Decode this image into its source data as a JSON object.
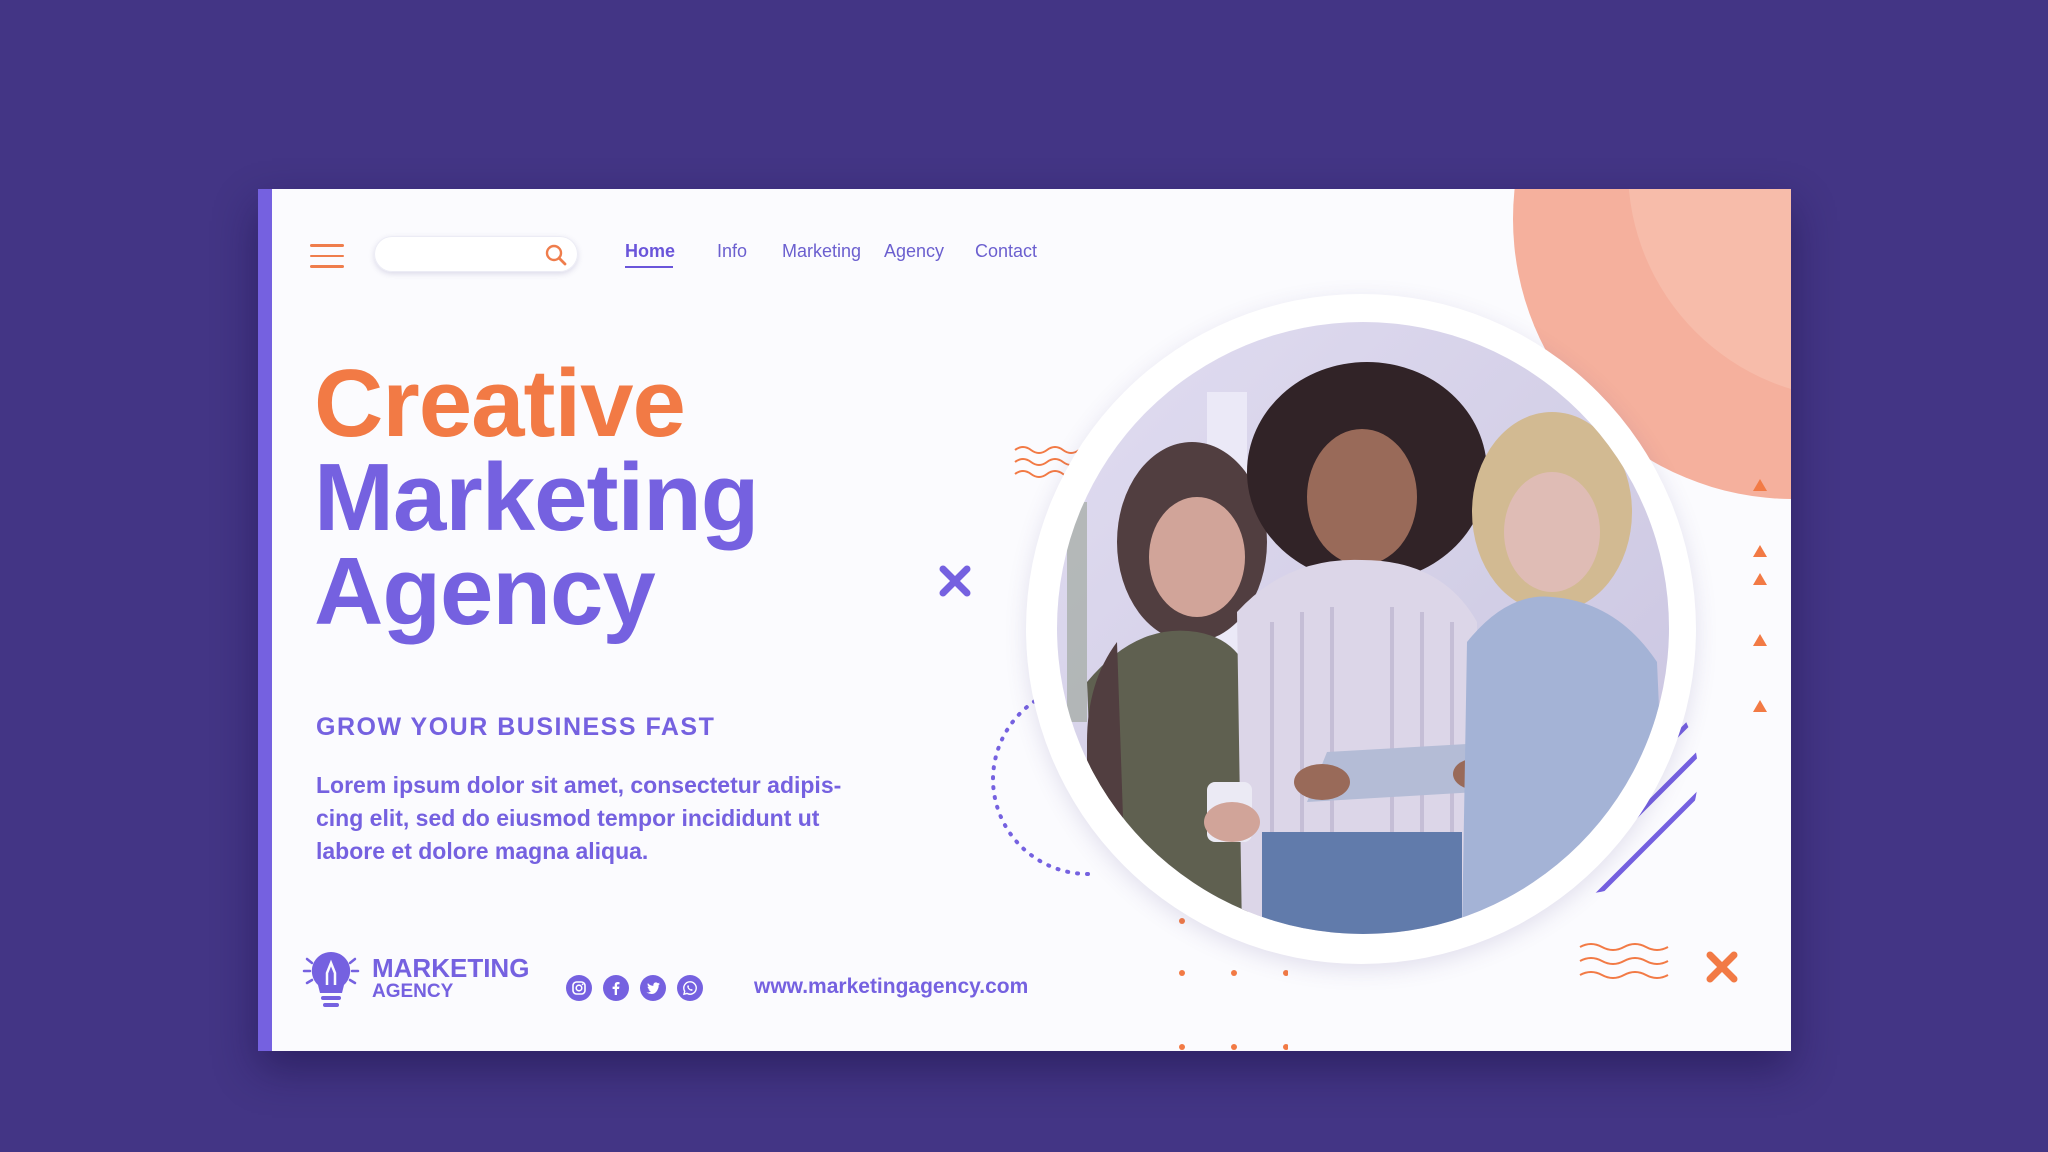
{
  "nav": {
    "items": [
      {
        "label": "Home",
        "active": true
      },
      {
        "label": "Info",
        "active": false
      },
      {
        "label": "Marketing",
        "active": false
      },
      {
        "label": "Agency",
        "active": false
      },
      {
        "label": "Contact",
        "active": false
      }
    ]
  },
  "search": {
    "placeholder": "",
    "value": ""
  },
  "hero": {
    "title_line1": "Creative",
    "title_line2": "Marketing",
    "title_line3": "Agency",
    "subtitle": "GROW YOUR BUSINESS FAST",
    "description_lines": [
      "Lorem ipsum dolor sit amet, consectetur adipis-",
      "cing elit, sed do eiusmod tempor incididunt ut",
      "labore et dolore magna aliqua."
    ]
  },
  "footer": {
    "brand_line1": "MARKETING",
    "brand_line2": "AGENCY",
    "social_icons": [
      "instagram-icon",
      "facebook-icon",
      "twitter-icon",
      "whatsapp-icon"
    ],
    "url": "www.marketingagency.com"
  },
  "colors": {
    "background": "#433585",
    "purple": "#7561e0",
    "orange": "#f27a45",
    "peach": "#f5b09d"
  }
}
